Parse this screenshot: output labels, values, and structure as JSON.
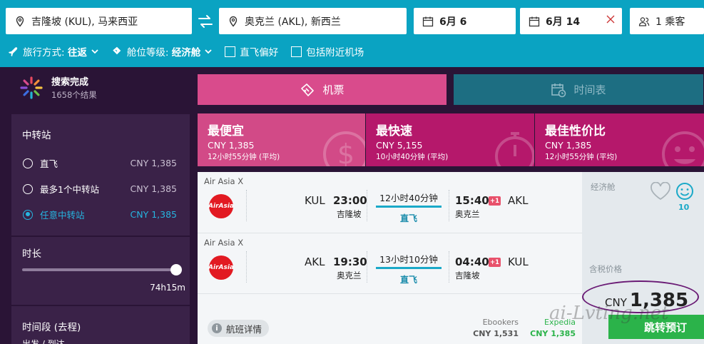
{
  "search": {
    "from": "吉隆坡 (KUL), 马来西亚",
    "to": "奥克兰 (AKL), 新西兰",
    "depart_date": "6月 6",
    "return_date": "6月 14",
    "passengers": "1 乘客"
  },
  "options": {
    "trip_label": "旅行方式:",
    "trip_value": "往返",
    "cabin_label": "舱位等级:",
    "cabin_value": "经济舱",
    "direct_pref": "直飞偏好",
    "nearby": "包括附近机场"
  },
  "status": {
    "title": "搜索完成",
    "count": "1658个结果"
  },
  "filters": {
    "stops_title": "中转站",
    "stops": [
      {
        "label": "直飞",
        "price": "CNY 1,385"
      },
      {
        "label": "最多1个中转站",
        "price": "CNY 1,385"
      },
      {
        "label": "任意中转站",
        "price": "CNY 1,385"
      }
    ],
    "duration_title": "时长",
    "duration_value": "74h15m",
    "duration_fraction": 1.0,
    "timeslot_title": "时间段 (去程)",
    "timeslot_sub": "出发 / 到达"
  },
  "tabs": {
    "flights": "机票",
    "timetable": "时间表"
  },
  "sort": [
    {
      "name": "最便宜",
      "price": "CNY  1,385",
      "dur": "12小时55分钟 (平均)"
    },
    {
      "name": "最快速",
      "price": "CNY  5,155",
      "dur": "10小时40分钟 (平均)"
    },
    {
      "name": "最佳性价比",
      "price": "CNY  1,385",
      "dur": "12小时55分钟 (平均)"
    }
  ],
  "result": {
    "legs": [
      {
        "airline": "Air Asia X",
        "logo": "AirAsia",
        "dep_code": "KUL",
        "dep_time": "23:00",
        "dep_city": "吉隆坡",
        "duration": "12小时40分钟",
        "stops": "直飞",
        "arr_time": "15:40",
        "plus": "+1",
        "arr_code": "AKL",
        "arr_city": "奥克兰"
      },
      {
        "airline": "Air Asia X",
        "logo": "AirAsia",
        "dep_code": "AKL",
        "dep_time": "19:30",
        "dep_city": "奥克兰",
        "duration": "13小时10分钟",
        "stops": "直飞",
        "arr_time": "04:40",
        "plus": "+1",
        "arr_code": "KUL",
        "arr_city": "吉隆坡"
      }
    ],
    "cabin": "经济舱",
    "rating": "10",
    "tax_label": "含税价格",
    "currency": "CNY",
    "total": "1,385",
    "goto": "跳转预订",
    "details": "航班详情",
    "providers": [
      {
        "name": "Ebookers",
        "price": "CNY  1,531"
      },
      {
        "name": "Expedia",
        "price": "CNY  1,385"
      }
    ]
  },
  "watermark": "ai-Lvting.net",
  "colors": {
    "topbar": "#0aa3c2",
    "accent_pink": "#d94b8c",
    "magenta": "#b5186b",
    "green": "#2bb34a",
    "cyan": "#1aa9c8"
  }
}
